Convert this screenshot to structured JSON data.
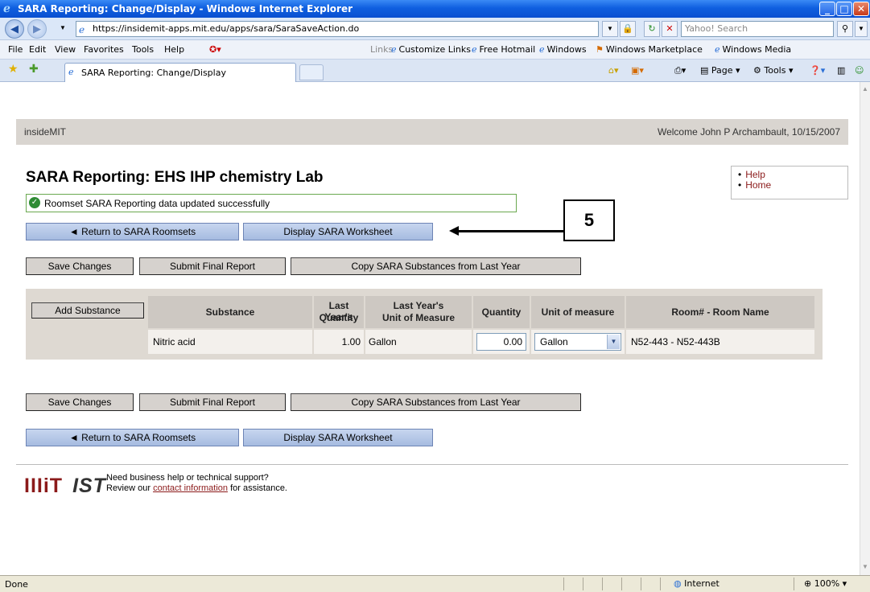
{
  "window": {
    "title": "SARA Reporting: Change/Display - Windows Internet Explorer",
    "url": "https://insidemit-apps.mit.edu/apps/sara/SaraSaveAction.do",
    "search_placeholder": "Yahoo! Search",
    "tab_title": "SARA Reporting: Change/Display"
  },
  "menu": {
    "items": [
      "File",
      "Edit",
      "View",
      "Favorites",
      "Tools",
      "Help"
    ],
    "links_label": "Links",
    "links": [
      "Customize Links",
      "Free Hotmail",
      "Windows",
      "Windows Marketplace",
      "Windows Media"
    ]
  },
  "toolbar": {
    "page_label": "Page",
    "tools_label": "Tools"
  },
  "header": {
    "site": "insideMIT",
    "welcome": "Welcome John P Archambault, 10/15/2007"
  },
  "page": {
    "title": "SARA Reporting: EHS IHP chemistry Lab",
    "help_links": [
      "Help",
      "Home"
    ],
    "success_message": "Roomset SARA Reporting data updated successfully",
    "return_button": "◄ Return to SARA Roomsets",
    "worksheet_button": "Display SARA Worksheet",
    "save_button": "Save Changes",
    "submit_button": "Submit Final Report",
    "copy_button": "Copy SARA Substances from Last Year",
    "callout_number": "5"
  },
  "table": {
    "add_button": "Add Substance",
    "headers": {
      "substance": "Substance",
      "last_qty_1": "Last Year's",
      "last_qty_2": "Quantity",
      "last_uom_1": "Last Year's",
      "last_uom_2": "Unit of Measure",
      "quantity": "Quantity",
      "uom": "Unit of measure",
      "room": "Room# - Room Name"
    },
    "row": {
      "substance": "Nitric acid",
      "last_qty": "1.00",
      "last_uom": "Gallon",
      "quantity": "0.00",
      "uom": "Gallon",
      "room": "N52-443 - N52-443B"
    }
  },
  "footer": {
    "logo_mit": "ΙΙΙiΤ",
    "logo_ist": "ΙSΤ",
    "line1": "Need business help or technical support?",
    "line2_pre": "Review our ",
    "link": "contact information",
    "line2_post": " for assistance."
  },
  "status": {
    "left": "Done",
    "zone": "Internet",
    "zoom": "100%"
  }
}
